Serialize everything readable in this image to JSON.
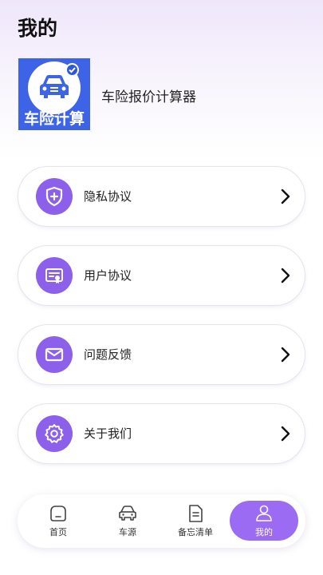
{
  "page": {
    "title": "我的"
  },
  "app": {
    "logo_text": "车险计算",
    "name": "车险报价计算器"
  },
  "menu": [
    {
      "label": "隐私协议",
      "icon": "shield-plus-icon"
    },
    {
      "label": "用户协议",
      "icon": "certificate-icon"
    },
    {
      "label": "问题反馈",
      "icon": "mail-icon"
    },
    {
      "label": "关于我们",
      "icon": "gear-icon"
    }
  ],
  "tabbar": [
    {
      "label": "首页",
      "icon": "home-icon",
      "active": false
    },
    {
      "label": "车源",
      "icon": "car-icon",
      "active": false
    },
    {
      "label": "备忘清单",
      "icon": "document-icon",
      "active": false
    },
    {
      "label": "我的",
      "icon": "person-icon",
      "active": true
    }
  ],
  "colors": {
    "accent": "#8d60ec",
    "tab_active": "#9b6cf3",
    "logo_bg": "#3d63e6"
  }
}
